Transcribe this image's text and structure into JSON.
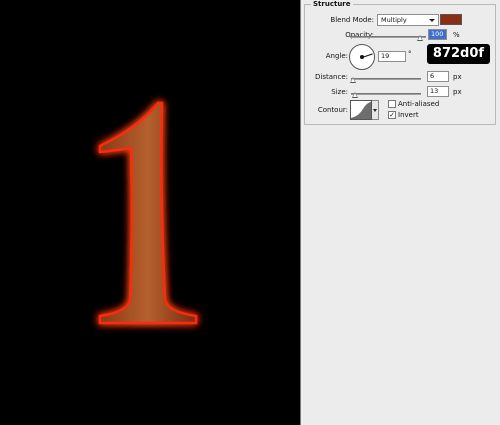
{
  "canvas": {
    "glyph": "1",
    "glyph_color": "#872d0f"
  },
  "panel": {
    "section_title": "Structure",
    "blend_mode": {
      "label": "Blend Mode:",
      "value": "Multiply",
      "color": "#8a2f14"
    },
    "opacity": {
      "label": "Opacity:",
      "value": "100",
      "unit": "%",
      "level": 1.0
    },
    "angle": {
      "label": "Angle:",
      "value": "19",
      "unit": "°"
    },
    "distance": {
      "label": "Distance:",
      "value": "6",
      "unit": "px",
      "level": 0.03
    },
    "size": {
      "label": "Size:",
      "value": "13",
      "unit": "px",
      "level": 0.05
    },
    "contour": {
      "label": "Contour:"
    },
    "anti_aliased": {
      "label": "Anti-aliased",
      "checked": false
    },
    "invert": {
      "label": "Invert",
      "checked": true,
      "mark": "✓"
    }
  },
  "overlay_tag": {
    "text": "872d0f"
  },
  "icons": {
    "dial": "angle-dial-icon",
    "contour": "contour-curve-icon"
  }
}
